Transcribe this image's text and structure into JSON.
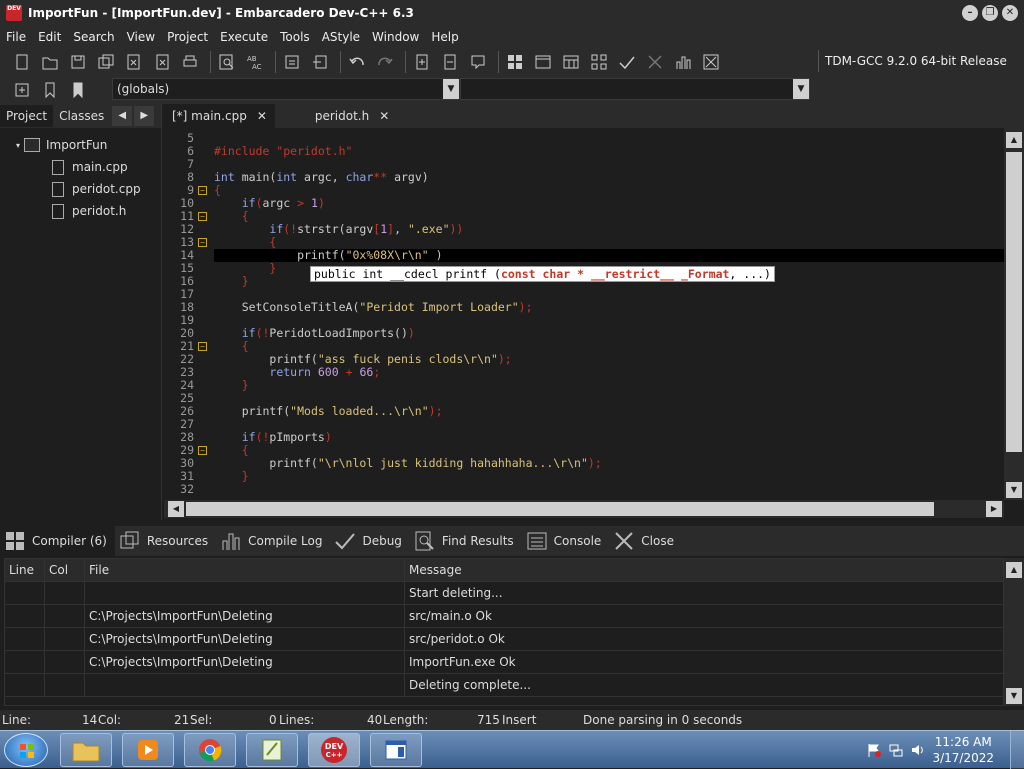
{
  "window": {
    "title": "ImportFun - [ImportFun.dev] - Embarcadero Dev-C++ 6.3",
    "app_icon_text": "DEV"
  },
  "menu": [
    "File",
    "Edit",
    "Search",
    "View",
    "Project",
    "Execute",
    "Tools",
    "AStyle",
    "Window",
    "Help"
  ],
  "compiler": "TDM-GCC 9.2.0 64-bit Release",
  "scope": "(globals)",
  "left_panel": {
    "tabs": [
      "Project",
      "Classes"
    ],
    "project": "ImportFun",
    "files": [
      "main.cpp",
      "peridot.cpp",
      "peridot.h"
    ]
  },
  "editor": {
    "tabs": [
      {
        "label": "[*] main.cpp"
      },
      {
        "label": "peridot.h"
      }
    ],
    "tab_close": "✕",
    "line_numbers": [
      "5",
      "6",
      "7",
      "8",
      "9",
      "10",
      "11",
      "12",
      "13",
      "14",
      "15",
      "16",
      "17",
      "18",
      "19",
      "20",
      "21",
      "22",
      "23",
      "24",
      "25",
      "26",
      "27",
      "28",
      "29",
      "30",
      "31",
      "32"
    ],
    "tooltip": "public int __cdecl printf (const char * __restrict__ _Format, ...)"
  },
  "bottom_tabs": [
    "Compiler (6)",
    "Resources",
    "Compile Log",
    "Debug",
    "Find Results",
    "Console",
    "Close"
  ],
  "messages": {
    "columns": [
      "Line",
      "Col",
      "File",
      "Message"
    ],
    "rows": [
      {
        "line": "",
        "col": "",
        "file": "",
        "message": "Start deleting..."
      },
      {
        "line": "",
        "col": "",
        "file": "C:\\Projects\\ImportFun\\Deleting",
        "message": "src/main.o Ok"
      },
      {
        "line": "",
        "col": "",
        "file": "C:\\Projects\\ImportFun\\Deleting",
        "message": "src/peridot.o Ok"
      },
      {
        "line": "",
        "col": "",
        "file": "C:\\Projects\\ImportFun\\Deleting",
        "message": "ImportFun.exe Ok"
      },
      {
        "line": "",
        "col": "",
        "file": "",
        "message": "Deleting complete..."
      }
    ]
  },
  "status": {
    "line_label": "Line:",
    "line_value": "14",
    "col_label": "Col:",
    "col_value": "21",
    "sel_label": "Sel:",
    "sel_value": "0",
    "lines_label": "Lines:",
    "lines_value": "40",
    "length_label": "Length:",
    "length_value": "715",
    "mode": "Insert",
    "message": "Done parsing in 0 seconds"
  },
  "taskbar": {
    "time": "11:26 AM",
    "date": "3/17/2022"
  },
  "colors": {
    "accent": "#c8262b",
    "keyword": "#8fa4e6",
    "string": "#d9c27a",
    "operator": "#c03a2b"
  }
}
